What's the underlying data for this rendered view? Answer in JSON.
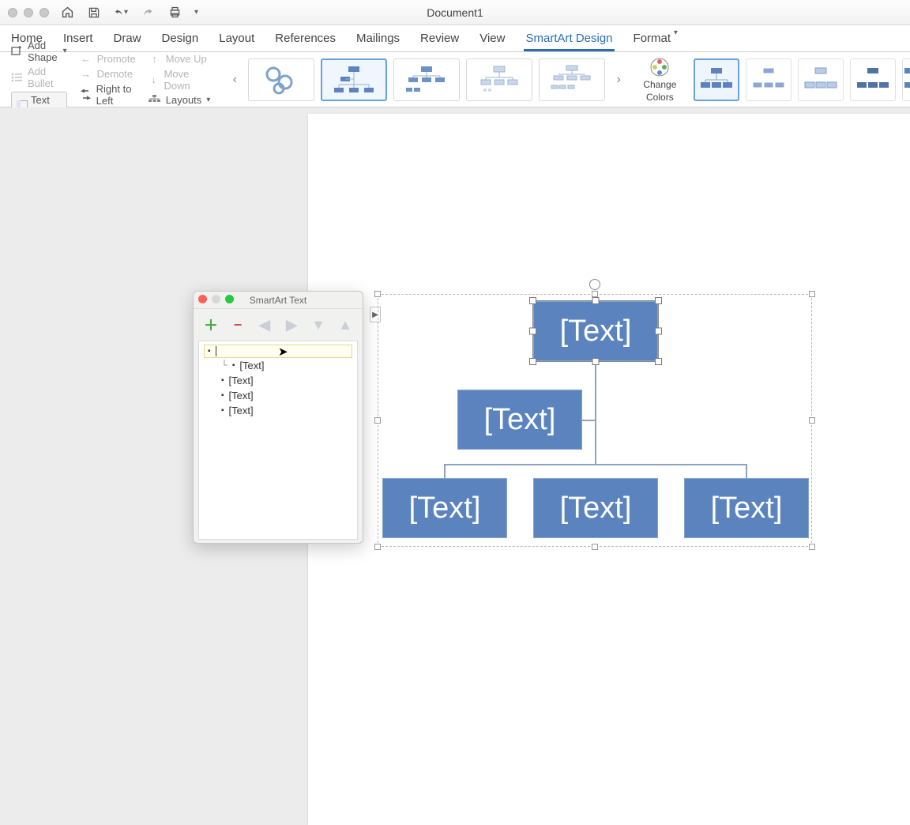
{
  "window": {
    "title": "Document1"
  },
  "tabs": {
    "items": [
      "Home",
      "Insert",
      "Draw",
      "Design",
      "Layout",
      "References",
      "Mailings",
      "Review",
      "View",
      "SmartArt Design",
      "Format"
    ],
    "active_index": 9
  },
  "ribbon": {
    "add_shape": "Add Shape",
    "add_bullet": "Add Bullet",
    "text_pane": "Text Pane",
    "promote": "Promote",
    "demote": "Demote",
    "rtl": "Right to Left",
    "move_up": "Move Up",
    "move_down": "Move Down",
    "layouts": "Layouts",
    "change_colors": "Change Colors",
    "change": "Change",
    "colors": "Colors"
  },
  "text_pane": {
    "title": "SmartArt Text",
    "items": [
      {
        "level": 0,
        "text": "",
        "active": true
      },
      {
        "level": 1,
        "text": "[Text]",
        "connector": true
      },
      {
        "level": 1,
        "text": "[Text]"
      },
      {
        "level": 1,
        "text": "[Text]"
      },
      {
        "level": 1,
        "text": "[Text]"
      }
    ]
  },
  "smartart": {
    "node_placeholder": "[Text]",
    "nodes": {
      "top": "[Text]",
      "assistant": "[Text]",
      "child1": "[Text]",
      "child2": "[Text]",
      "child3": "[Text]"
    }
  }
}
